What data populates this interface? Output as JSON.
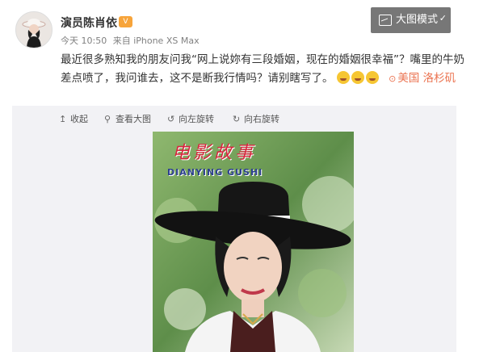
{
  "post": {
    "author": "演员陈肖依",
    "badge": "V",
    "time": "今天 10:50",
    "source": "来自 iPhone XS Max",
    "text": "最近很多熟知我的朋友问我“网上说妳有三段婚姻，现在的婚姻很幸福”？嘴里的牛奶差点喷了，我问谁去，这不是断我行情吗？请别瞎写了。",
    "emoji_names": [
      "laugh-cry-emoji",
      "laugh-cry-emoji",
      "laugh-cry-emoji"
    ],
    "location": "美国 洛杉矶"
  },
  "big_mode": {
    "label": "大图模式"
  },
  "viewer": {
    "toolbar": [
      {
        "name": "collapse",
        "icon": "up-arrow-icon",
        "label": "收起"
      },
      {
        "name": "view-large",
        "icon": "search-icon",
        "label": "查看大图"
      },
      {
        "name": "rotate-left",
        "icon": "rotate-left-icon",
        "label": "向左旋转"
      },
      {
        "name": "rotate-right",
        "icon": "rotate-right-icon",
        "label": "向右旋转"
      }
    ]
  },
  "image": {
    "title_text": "电影故事",
    "subtitle_text": "DIANYING GUSHI"
  },
  "colors": {
    "location": "#eb7350",
    "author": "#333333",
    "meta": "#808080",
    "viewer_bg": "#f2f2f5",
    "big_mode_bg": "#777777"
  }
}
